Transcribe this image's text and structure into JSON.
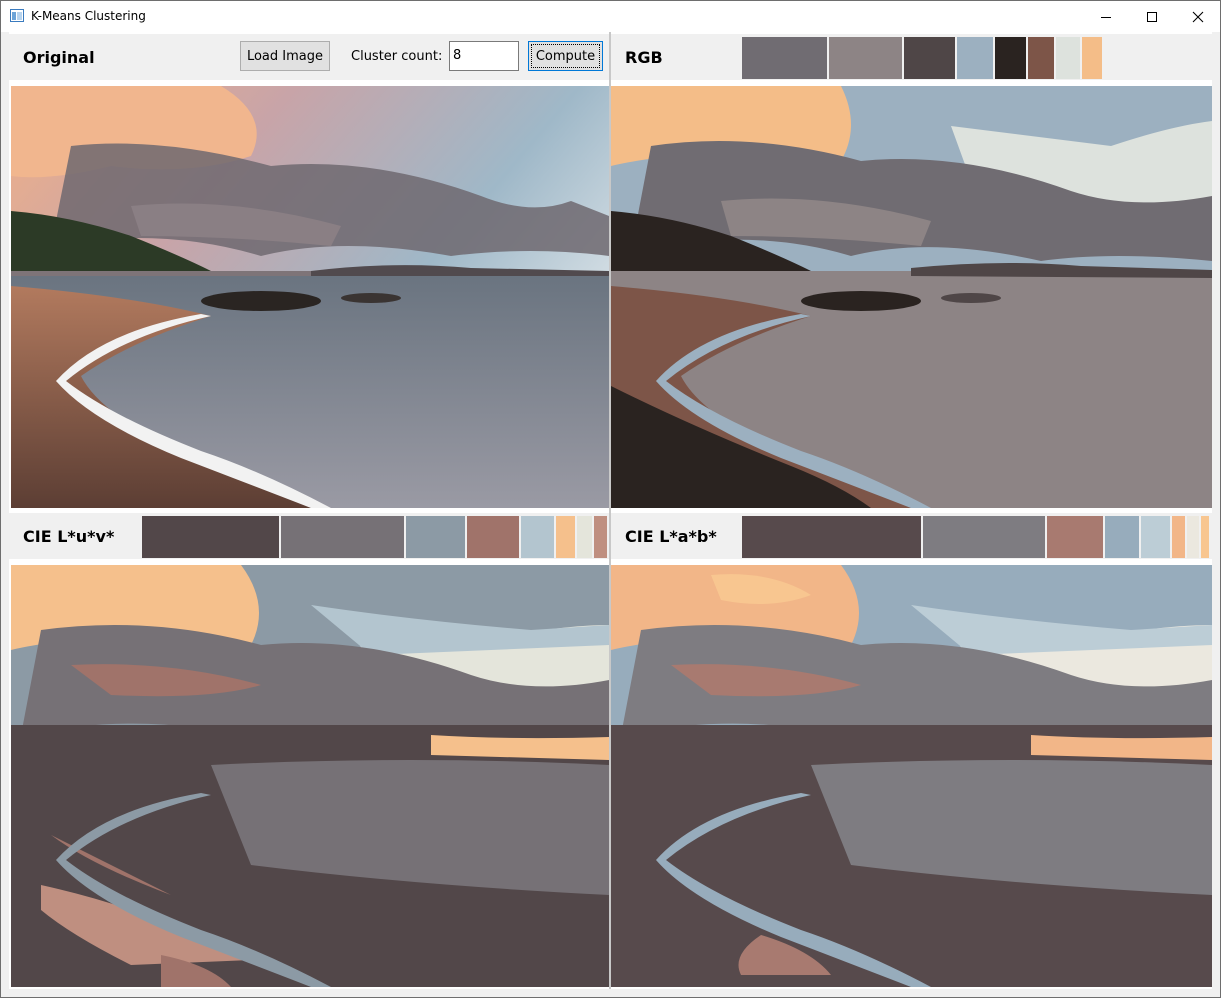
{
  "window": {
    "title": "K-Means Clustering",
    "controls": [
      "minimize-icon",
      "maximize-icon",
      "close-icon"
    ]
  },
  "original": {
    "title": "Original",
    "load_button": "Load Image",
    "cluster_label": "Cluster count:",
    "cluster_value": "8",
    "compute_button": "Compute"
  },
  "rgb": {
    "title": "RGB",
    "palette": [
      {
        "color": "#706c72",
        "share": 0.186
      },
      {
        "color": "#8d8485",
        "share": 0.16
      },
      {
        "color": "#4f4647",
        "share": 0.112
      },
      {
        "color": "#9cb0c0",
        "share": 0.081
      },
      {
        "color": "#2a2320",
        "share": 0.07
      },
      {
        "color": "#7d5548",
        "share": 0.06
      },
      {
        "color": "#dde2dd",
        "share": 0.055
      },
      {
        "color": "#f4bd88",
        "share": 0.047
      }
    ]
  },
  "luv": {
    "title": "CIE L*u*v*",
    "palette": [
      {
        "color": "#524749",
        "share": 0.298
      },
      {
        "color": "#767176",
        "share": 0.27
      },
      {
        "color": "#8c9aa5",
        "share": 0.13
      },
      {
        "color": "#a0736a",
        "share": 0.115
      },
      {
        "color": "#b3c5cf",
        "share": 0.074
      },
      {
        "color": "#f5c08c",
        "share": 0.044
      },
      {
        "color": "#e4e5db",
        "share": 0.037
      },
      {
        "color": "#bf8f80",
        "share": 0.032
      }
    ]
  },
  "lab": {
    "title": "CIE L*a*b*",
    "palette": [
      {
        "color": "#574a4c",
        "share": 0.385
      },
      {
        "color": "#7e7c81",
        "share": 0.264
      },
      {
        "color": "#a87a70",
        "share": 0.124
      },
      {
        "color": "#97acbc",
        "share": 0.076
      },
      {
        "color": "#bccdd6",
        "share": 0.067
      },
      {
        "color": "#f2b688",
        "share": 0.032
      },
      {
        "color": "#ebe8df",
        "share": 0.03
      },
      {
        "color": "#f8c690",
        "share": 0.022
      }
    ]
  }
}
